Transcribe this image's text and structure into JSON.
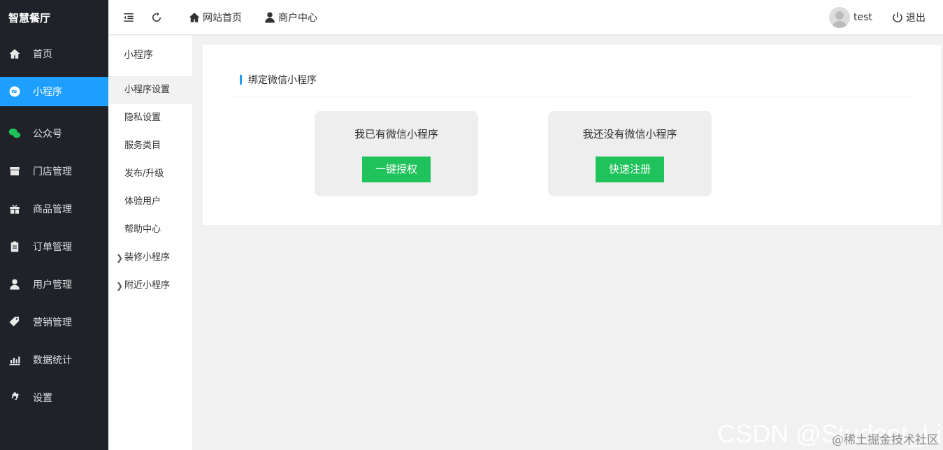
{
  "sidebar": {
    "brand": "智慧餐厅",
    "items": [
      {
        "label": "首页",
        "icon": "home-icon"
      },
      {
        "label": "小程序",
        "icon": "miniprogram-icon",
        "active": true
      },
      {
        "label": "公众号",
        "icon": "wechat-icon"
      },
      {
        "label": "门店管理",
        "icon": "store-icon"
      },
      {
        "label": "商品管理",
        "icon": "gift-icon"
      },
      {
        "label": "订单管理",
        "icon": "clipboard-icon"
      },
      {
        "label": "用户管理",
        "icon": "user-icon"
      },
      {
        "label": "营销管理",
        "icon": "tags-icon"
      },
      {
        "label": "数据统计",
        "icon": "chart-icon"
      },
      {
        "label": "设置",
        "icon": "gear-icon"
      }
    ]
  },
  "submenu": {
    "title": "小程序",
    "items": [
      {
        "label": "小程序设置",
        "active": true
      },
      {
        "label": "隐私设置"
      },
      {
        "label": "服务类目"
      },
      {
        "label": "发布/升级"
      },
      {
        "label": "体验用户"
      },
      {
        "label": "帮助中心"
      },
      {
        "label": "装修小程序",
        "expandable": true
      },
      {
        "label": "附近小程序",
        "expandable": true
      }
    ]
  },
  "topbar": {
    "home_label": "网站首页",
    "merchant_label": "商户中心",
    "username": "test",
    "logout_label": "退出"
  },
  "main": {
    "section_title": "绑定微信小程序",
    "cards": [
      {
        "text": "我已有微信小程序",
        "button": "一键授权"
      },
      {
        "text": "我还没有微信小程序",
        "button": "快速注册"
      }
    ]
  },
  "watermark": {
    "main": "CSDN @Student_Li",
    "sub": "@稀土掘金技术社区"
  },
  "colors": {
    "sidebar_bg": "#20222a",
    "active_blue": "#1e9fff",
    "button_green": "#1fc25b"
  }
}
